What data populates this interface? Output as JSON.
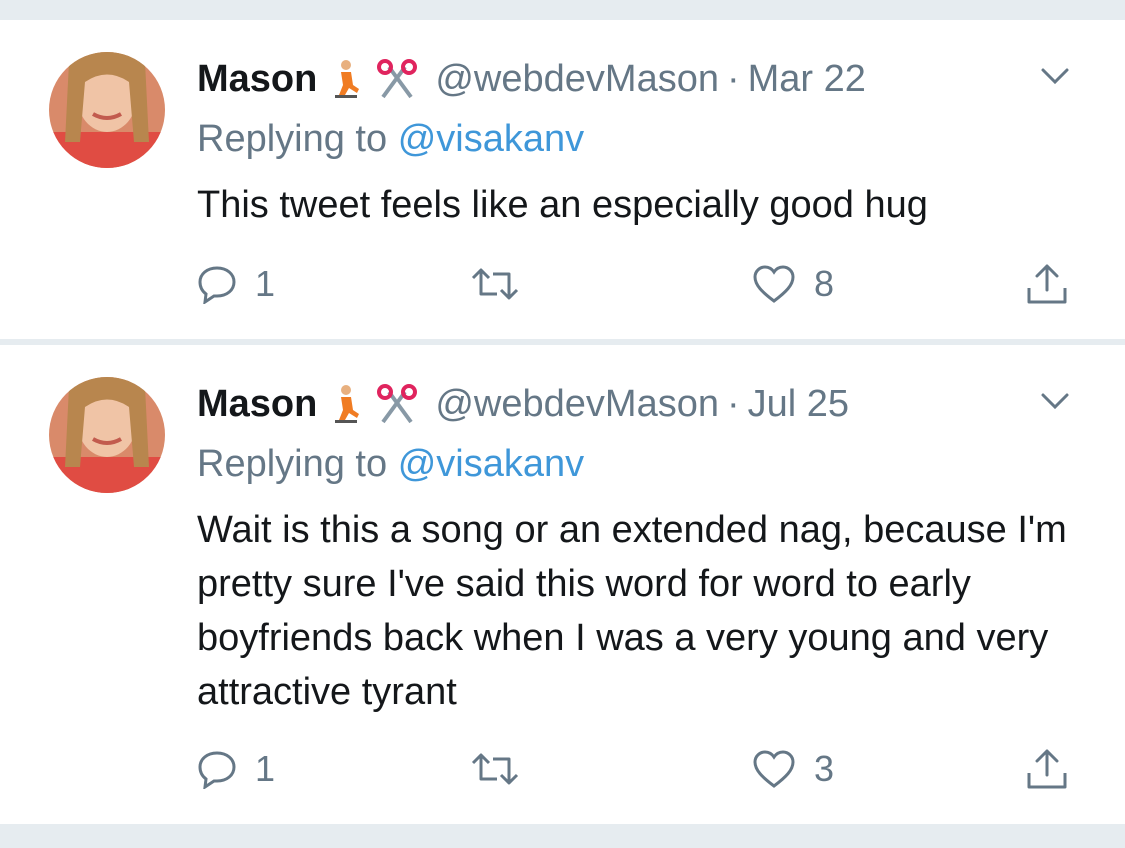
{
  "tweets": [
    {
      "name": "Mason",
      "handle": "@webdevMason",
      "separator": "·",
      "date": "Mar 22",
      "replying_prefix": "Replying to",
      "replying_to": "@visakanv",
      "text": "This tweet feels like an especially good hug",
      "reply_count": "1",
      "retweet_count": "",
      "like_count": "8",
      "name_emoji": [
        "person-kneeling-icon",
        "scissors-icon"
      ]
    },
    {
      "name": "Mason",
      "handle": "@webdevMason",
      "separator": "·",
      "date": "Jul 25",
      "replying_prefix": "Replying to",
      "replying_to": "@visakanv",
      "text": "Wait is this a song or an extended nag, because I'm pretty sure I've said this word for word to early boyfriends back when I was a very young and very attractive tyrant",
      "reply_count": "1",
      "retweet_count": "",
      "like_count": "3",
      "name_emoji": [
        "person-kneeling-icon",
        "scissors-icon"
      ]
    }
  ],
  "colors": {
    "text_primary": "#14171a",
    "text_secondary": "#657786",
    "link": "#3f97d9",
    "divider": "#e6ecf0"
  }
}
